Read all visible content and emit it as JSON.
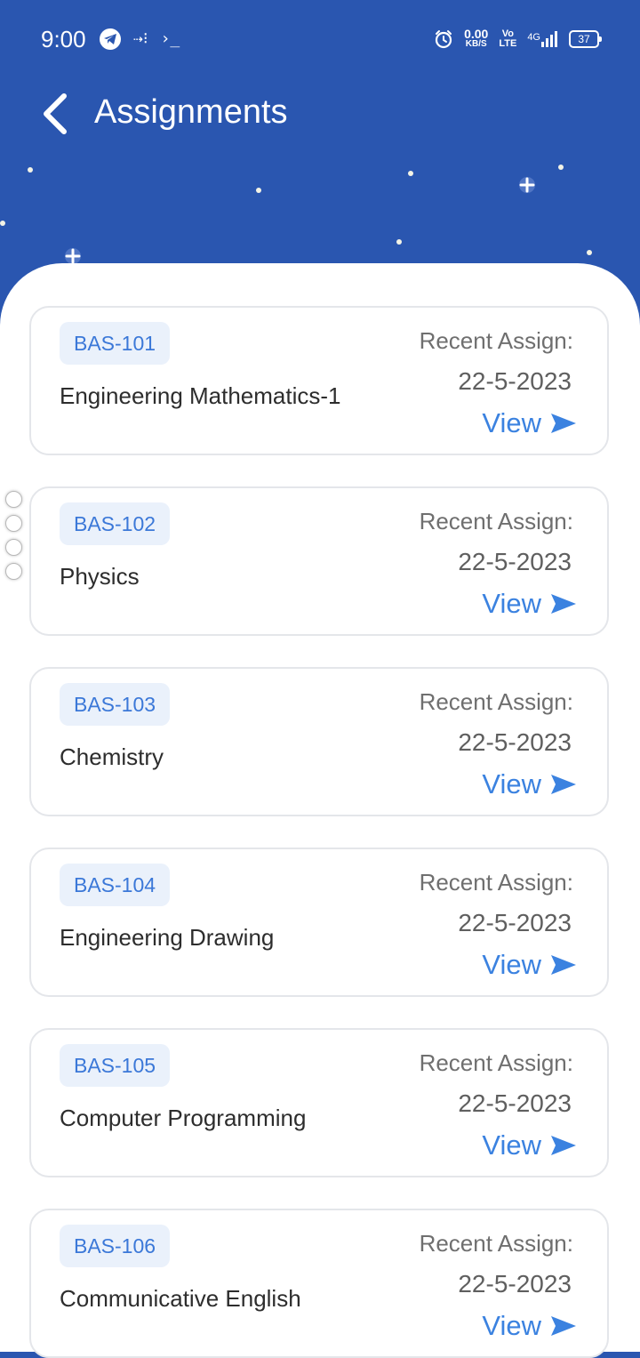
{
  "status_bar": {
    "time": "9:00",
    "terminal_glyph": "›_",
    "sync_glyph": "⇢⁝",
    "net_speed_value": "0.00",
    "net_speed_unit": "KB/S",
    "volte_top": "Vo",
    "volte_bottom": "LTE",
    "network": "4G",
    "battery": "37"
  },
  "header": {
    "title": "Assignments"
  },
  "courses": [
    {
      "code": "BAS-101",
      "name": "Engineering Mathematics-1",
      "recent_label": "Recent Assign:",
      "date": "22-5-2023",
      "view_label": "View"
    },
    {
      "code": "BAS-102",
      "name": "Physics",
      "recent_label": "Recent Assign:",
      "date": "22-5-2023",
      "view_label": "View"
    },
    {
      "code": "BAS-103",
      "name": "Chemistry",
      "recent_label": "Recent Assign:",
      "date": "22-5-2023",
      "view_label": "View"
    },
    {
      "code": "BAS-104",
      "name": "Engineering Drawing",
      "recent_label": "Recent Assign:",
      "date": "22-5-2023",
      "view_label": "View"
    },
    {
      "code": "BAS-105",
      "name": "Computer Programming",
      "recent_label": "Recent Assign:",
      "date": "22-5-2023",
      "view_label": "View"
    },
    {
      "code": "BAS-106",
      "name": "Communicative English",
      "recent_label": "Recent Assign:",
      "date": "22-5-2023",
      "view_label": "View"
    }
  ],
  "colors": {
    "header_bg": "#2a56b0",
    "accent": "#3b82e0",
    "badge_bg": "#eaf1fb",
    "card_border": "#e4e6ea"
  }
}
